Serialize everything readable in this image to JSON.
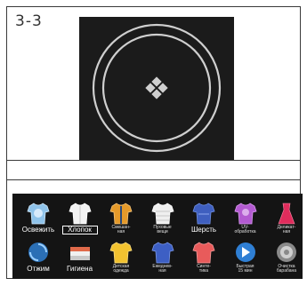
{
  "step_label": "3-3",
  "programs_row1": [
    {
      "label": "Освежить",
      "icon": "refresh-shirt-icon",
      "size": "big"
    },
    {
      "label": "Хлопок",
      "icon": "cotton-shirt-icon",
      "size": "big",
      "selected": true
    },
    {
      "label": "Смешан-\nная",
      "icon": "mixed-jacket-icon",
      "size": "small"
    },
    {
      "label": "Пуховые\nвещи",
      "icon": "down-jacket-icon",
      "size": "small"
    },
    {
      "label": "Шерсть",
      "icon": "wool-sweater-icon",
      "size": "big"
    },
    {
      "label": "UV-\nобработка",
      "icon": "uv-shirt-icon",
      "size": "small"
    },
    {
      "label": "Деликат-\nная",
      "icon": "delicate-dress-icon",
      "size": "small"
    }
  ],
  "programs_row2": [
    {
      "label": "Отжим",
      "icon": "spin-icon",
      "size": "big"
    },
    {
      "label": "Гигиена",
      "icon": "hygiene-towel-icon",
      "size": "big"
    },
    {
      "label": "Детская\nодежда",
      "icon": "kids-clothes-icon",
      "size": "small"
    },
    {
      "label": "Ежеднев-\nная",
      "icon": "daily-shirt-icon",
      "size": "small"
    },
    {
      "label": "Синте-\nтика",
      "icon": "synthetic-shirt-icon",
      "size": "small"
    },
    {
      "label": "Быстрая\n15 мин",
      "icon": "quick-15-icon",
      "size": "small"
    },
    {
      "label": "Очистка\nбарабана",
      "icon": "drum-clean-icon",
      "size": "small"
    }
  ],
  "colors": {
    "panel": "#1b1b1b",
    "strip": "#141414",
    "ring": "#cfcfcf"
  }
}
